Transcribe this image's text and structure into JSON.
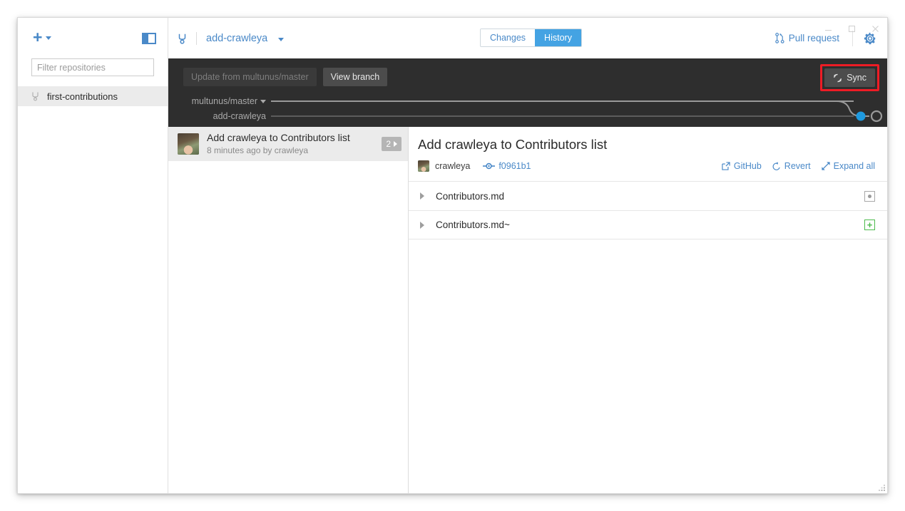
{
  "window": {
    "controls": [
      {
        "name": "minimize",
        "glyph": "minimize-icon"
      },
      {
        "name": "maximize",
        "glyph": "maximize-icon"
      },
      {
        "name": "close",
        "glyph": "close-icon"
      }
    ]
  },
  "sidebar": {
    "add_button_label": "+",
    "filter": {
      "placeholder": "Filter repositories",
      "value": ""
    },
    "repositories": [
      {
        "name": "first-contributions",
        "icon": "branch-icon",
        "selected": true
      }
    ]
  },
  "topbar": {
    "branch_icon": "branch-icon",
    "branch_name": "add-crawleya",
    "tabs": [
      {
        "label": "Changes",
        "active": false
      },
      {
        "label": "History",
        "active": true
      }
    ],
    "pull_request_label": "Pull request",
    "pull_request_icon": "pull-request-icon",
    "settings_icon": "gear-icon"
  },
  "darkbar": {
    "update_button_label": "Update from multunus/master",
    "view_branch_button_label": "View branch",
    "sync_button_label": "Sync",
    "sync_icon": "sync-icon",
    "sync_highlight_color": "#ee1c25",
    "graph": {
      "rows": [
        {
          "label": "multunus/master",
          "has_caret": true
        },
        {
          "label": "add-crawleya",
          "has_caret": false
        }
      ],
      "node_color": "#1e9ae0",
      "line_color": "#9a9a9a"
    }
  },
  "commit_list": [
    {
      "title": "Add crawleya to Contributors list",
      "subtitle": "8 minutes ago by crawleya",
      "badge_count": "2",
      "selected": true,
      "avatar": "crawleya-avatar"
    }
  ],
  "detail": {
    "title": "Add crawleya to Contributors list",
    "author": "crawleya",
    "hash": "f0961b1",
    "hash_icon": "commit-icon",
    "actions": [
      {
        "label": "GitHub",
        "icon": "external-link-icon"
      },
      {
        "label": "Revert",
        "icon": "revert-icon"
      },
      {
        "label": "Expand all",
        "icon": "expand-icon"
      }
    ],
    "files": [
      {
        "name": "Contributors.md",
        "status": "modified",
        "status_icon": "modified-icon"
      },
      {
        "name": "Contributors.md~",
        "status": "added",
        "status_icon": "added-icon"
      }
    ]
  },
  "colors": {
    "accent_blue": "#4a89c8",
    "tab_active": "#44a3e3",
    "dark_toolbar": "#2e2e2e",
    "selected_row": "#ebebeb",
    "added_green": "#4cbb4c",
    "highlight_red": "#ee1c25"
  }
}
